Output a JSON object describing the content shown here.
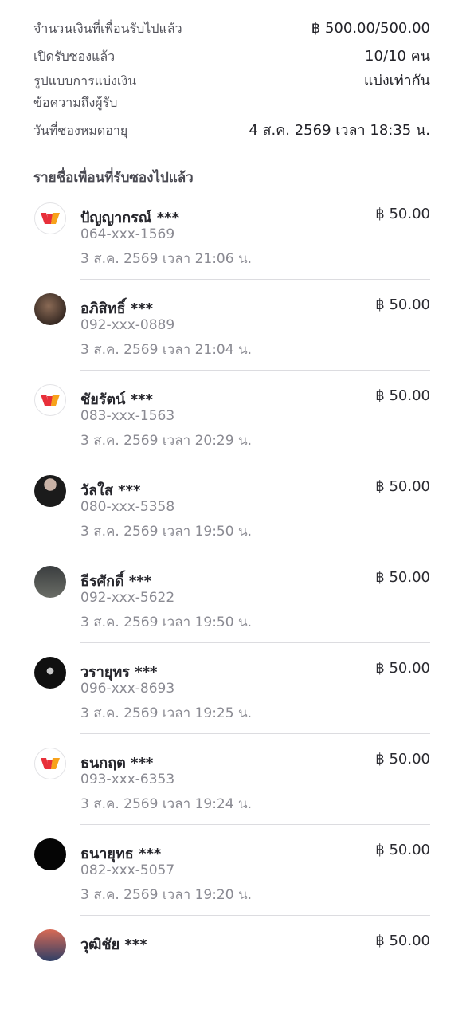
{
  "summary": {
    "rows": [
      {
        "label": "จำนวนเงินที่เพื่อนรับไปแล้ว",
        "value": "฿ 500.00/500.00"
      },
      {
        "label": "เปิดรับซองแล้ว",
        "value": "10/10 คน"
      },
      {
        "label": "รูปแบบการแบ่งเงิน",
        "value": "แบ่งเท่ากัน"
      },
      {
        "label": "ข้อความถึงผู้รับ",
        "value": ""
      },
      {
        "label": "วันที่ซองหมดอายุ",
        "value": "4 ส.ค. 2569 เวลา 18:35 น."
      }
    ]
  },
  "section_title": "รายชื่อเพื่อนที่รับซองไปแล้ว",
  "recipients": [
    {
      "name": "ปัญญากรณ์ ***",
      "phone": "064-xxx-1569",
      "time": "3 ส.ค. 2569 เวลา 21:06 น.",
      "amount": "฿ 50.00",
      "avatar": "logo"
    },
    {
      "name": "อภิสิทธิ์ ***",
      "phone": "092-xxx-0889",
      "time": "3 ส.ค. 2569 เวลา 21:04 น.",
      "amount": "฿ 50.00",
      "avatar": "photo"
    },
    {
      "name": "ชัยรัตน์ ***",
      "phone": "083-xxx-1563",
      "time": "3 ส.ค. 2569 เวลา 20:29 น.",
      "amount": "฿ 50.00",
      "avatar": "logo"
    },
    {
      "name": "วัลใส ***",
      "phone": "080-xxx-5358",
      "time": "3 ส.ค. 2569 เวลา 19:50 น.",
      "amount": "฿ 50.00",
      "avatar": "photo"
    },
    {
      "name": "ธีรศักดิ์ ***",
      "phone": "092-xxx-5622",
      "time": "3 ส.ค. 2569 เวลา 19:50 น.",
      "amount": "฿ 50.00",
      "avatar": "photo"
    },
    {
      "name": "วรายุทร ***",
      "phone": "096-xxx-8693",
      "time": "3 ส.ค. 2569 เวลา 19:25 น.",
      "amount": "฿ 50.00",
      "avatar": "photo"
    },
    {
      "name": "ธนกฤต ***",
      "phone": "093-xxx-6353",
      "time": "3 ส.ค. 2569 เวลา 19:24 น.",
      "amount": "฿ 50.00",
      "avatar": "logo"
    },
    {
      "name": "ธนายุทธ ***",
      "phone": "082-xxx-5057",
      "time": "3 ส.ค. 2569 เวลา 19:20 น.",
      "amount": "฿ 50.00",
      "avatar": "photo"
    },
    {
      "name": "วุฒิชัย ***",
      "phone": "",
      "time": "",
      "amount": "฿ 50.00",
      "avatar": "photo"
    }
  ],
  "colors": {
    "logo_red": "#e8303a",
    "logo_orange": "#f7a21b"
  }
}
